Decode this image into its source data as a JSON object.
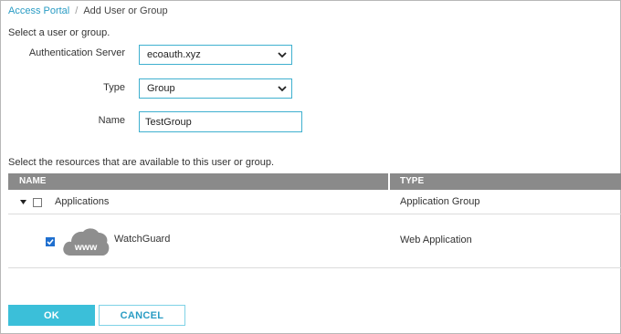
{
  "breadcrumb": {
    "root": "Access Portal",
    "separator": "/",
    "current": "Add User or Group"
  },
  "intro_text": "Select a user or group.",
  "form": {
    "auth_server": {
      "label": "Authentication Server",
      "value": "ecoauth.xyz"
    },
    "type": {
      "label": "Type",
      "value": "Group"
    },
    "name": {
      "label": "Name",
      "value": "TestGroup"
    }
  },
  "resources_text": "Select the resources that are available to this user or group.",
  "table": {
    "columns": [
      "NAME",
      "TYPE"
    ],
    "rows": [
      {
        "name": "Applications",
        "type": "Application Group",
        "checked": false,
        "expanded": true
      },
      {
        "name": "WatchGuard",
        "type": "Web Application",
        "checked": true,
        "icon_text": "www"
      }
    ]
  },
  "buttons": {
    "ok": "OK",
    "cancel": "CANCEL"
  },
  "colors": {
    "accent": "#3bbfd9",
    "link": "#2a9cc4",
    "header_bg": "#8a8a8a",
    "checkbox": "#1f6fcf",
    "cloud": "#8e8e8e"
  }
}
